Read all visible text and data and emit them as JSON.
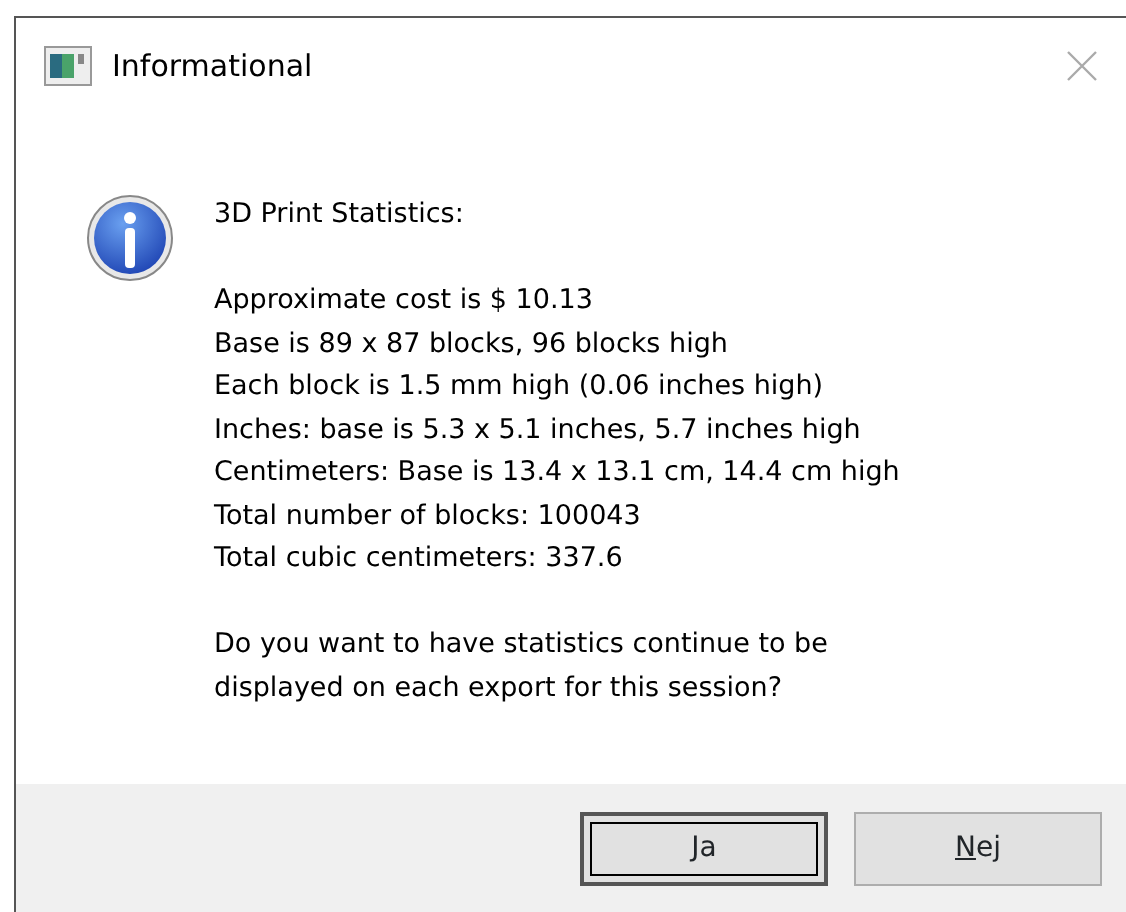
{
  "window": {
    "title": "Informational"
  },
  "message": {
    "heading": "3D Print Statistics:",
    "lines": [
      "Approximate cost is $ 10.13",
      "Base is 89 x 87 blocks, 96 blocks high",
      "Each block is 1.5 mm high (0.06 inches high)",
      "Inches: base is 5.3 x 5.1 inches, 5.7 inches high",
      "Centimeters: Base is 13.4 x 13.1 cm, 14.4 cm high",
      "Total number of blocks: 100043",
      "Total cubic centimeters: 337.6"
    ],
    "question_lines": [
      "Do you want to have statistics continue to be",
      "displayed on each export for this session?"
    ]
  },
  "buttons": [
    {
      "label": "Ja",
      "default": true
    },
    {
      "label": "Nej",
      "default": false
    }
  ]
}
